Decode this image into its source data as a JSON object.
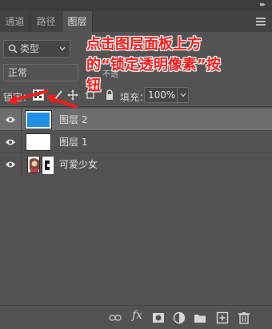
{
  "tabs": [
    {
      "label": "通道",
      "active": false
    },
    {
      "label": "路径",
      "active": false
    },
    {
      "label": "图层",
      "active": true
    }
  ],
  "filter": {
    "kind_label": "类型"
  },
  "blend": {
    "mode": "正常",
    "opacity_label_partial": "不透"
  },
  "lock": {
    "label": "锁定："
  },
  "fill": {
    "label": "填充：",
    "value": "100%"
  },
  "layers": [
    {
      "name": "图层 2",
      "selected": true,
      "thumbnail": "blue-fill",
      "thumbnail_color": "#1e90e8"
    },
    {
      "name": "图层 1",
      "selected": false,
      "thumbnail": "white-fill"
    },
    {
      "name": "可爱少女",
      "selected": false,
      "thumbnail": "photo-with-mask"
    }
  ],
  "annotation": {
    "line1": "点击图层面板上方",
    "line2": "的“锁定透明像素”按",
    "line3": "钮",
    "color": "#ff1a1a"
  },
  "bottom_icons": [
    "link-icon",
    "fx-icon",
    "add-mask-icon",
    "adjustment-icon",
    "group-folder-icon",
    "new-layer-icon",
    "delete-icon"
  ],
  "fx_label": "fx",
  "colors": {
    "panel": "#535353",
    "selected_row": "#6e6e6e",
    "accent_annotation": "#ff1a1a"
  }
}
